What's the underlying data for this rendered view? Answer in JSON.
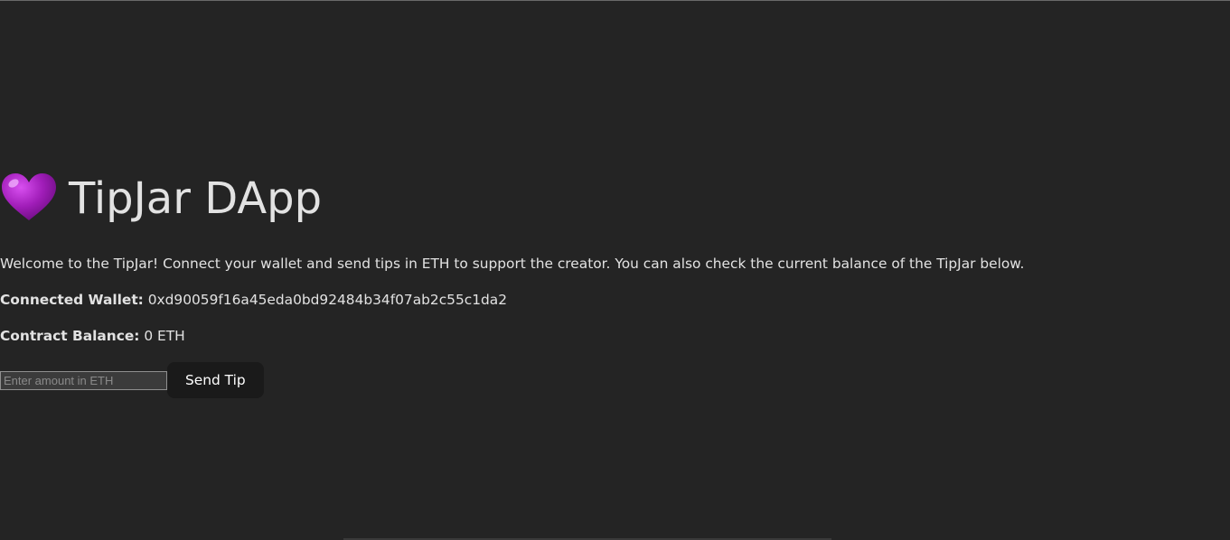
{
  "header": {
    "title": "TipJar DApp",
    "icon": "purple-heart-icon",
    "heart_color": "#a01db8"
  },
  "intro": {
    "text": "Welcome to the TipJar! Connect your wallet and send tips in ETH to support the creator. You can also check the current balance of the TipJar below."
  },
  "wallet": {
    "label": "Connected Wallet:",
    "address": "0xd90059f16a45eda0bd92484b34f07ab2c55c1da2"
  },
  "balance": {
    "label": "Contract Balance:",
    "value": "0 ETH"
  },
  "tip_form": {
    "amount_placeholder": "Enter amount in ETH",
    "amount_value": "",
    "send_label": "Send Tip"
  },
  "colors": {
    "background": "#242424",
    "text": "#dedede",
    "button_bg": "#1a1a1a"
  }
}
